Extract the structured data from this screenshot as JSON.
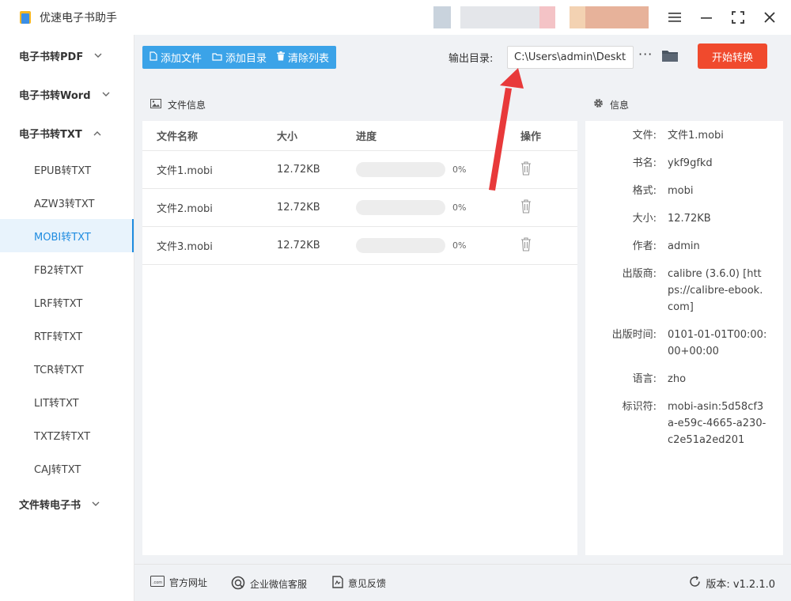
{
  "app": {
    "title": "优速电子书助手"
  },
  "sidebar": {
    "groups": [
      {
        "label": "电子书转PDF",
        "chevron": "﹀"
      },
      {
        "label": "电子书转Word",
        "chevron": "﹀"
      },
      {
        "label": "电子书转TXT",
        "chevron": "︿"
      },
      {
        "label": "文件转电子书",
        "chevron": "﹀"
      }
    ],
    "items": [
      "EPUB转TXT",
      "AZW3转TXT",
      "MOBI转TXT",
      "FB2转TXT",
      "LRF转TXT",
      "RTF转TXT",
      "TCR转TXT",
      "LIT转TXT",
      "TXTZ转TXT",
      "CAJ转TXT"
    ],
    "active_item": "MOBI转TXT"
  },
  "toolbar": {
    "add_file": "添加文件",
    "add_dir": "添加目录",
    "clear_list": "清除列表",
    "output_label": "输出目录:",
    "output_path": "C:\\Users\\admin\\Deskto",
    "more": "···",
    "start": "开始转换"
  },
  "file_panel": {
    "title": "文件信息",
    "columns": {
      "name": "文件名称",
      "size": "大小",
      "progress": "进度",
      "op": "操作"
    },
    "rows": [
      {
        "name": "文件1.mobi",
        "size": "12.72KB",
        "progress": 0,
        "pct": "0%"
      },
      {
        "name": "文件2.mobi",
        "size": "12.72KB",
        "progress": 0,
        "pct": "0%"
      },
      {
        "name": "文件3.mobi",
        "size": "12.72KB",
        "progress": 0,
        "pct": "0%"
      }
    ]
  },
  "info_panel": {
    "title": "信息",
    "rows": [
      {
        "k": "文件:",
        "v": "文件1.mobi"
      },
      {
        "k": "书名:",
        "v": "ykf9gfkd"
      },
      {
        "k": "格式:",
        "v": "mobi"
      },
      {
        "k": "大小:",
        "v": "12.72KB"
      },
      {
        "k": "作者:",
        "v": "admin"
      },
      {
        "k": "出版商:",
        "v": "calibre (3.6.0) [https://calibre-ebook.com]"
      },
      {
        "k": "出版时间:",
        "v": "0101-01-01T00:00:00+00:00"
      },
      {
        "k": "语言:",
        "v": "zho"
      },
      {
        "k": "标识符:",
        "v": "mobi-asin:5d58cf3a-e59c-4665-a230-c2e51a2ed201"
      }
    ]
  },
  "footer": {
    "website": "官方网址",
    "wechat": "企业微信客服",
    "feedback": "意见反馈",
    "version": "版本: v1.2.1.0"
  },
  "colors": {
    "accent": "#3ba3e8",
    "start": "#f04a2d",
    "arrow": "#e8393a"
  }
}
